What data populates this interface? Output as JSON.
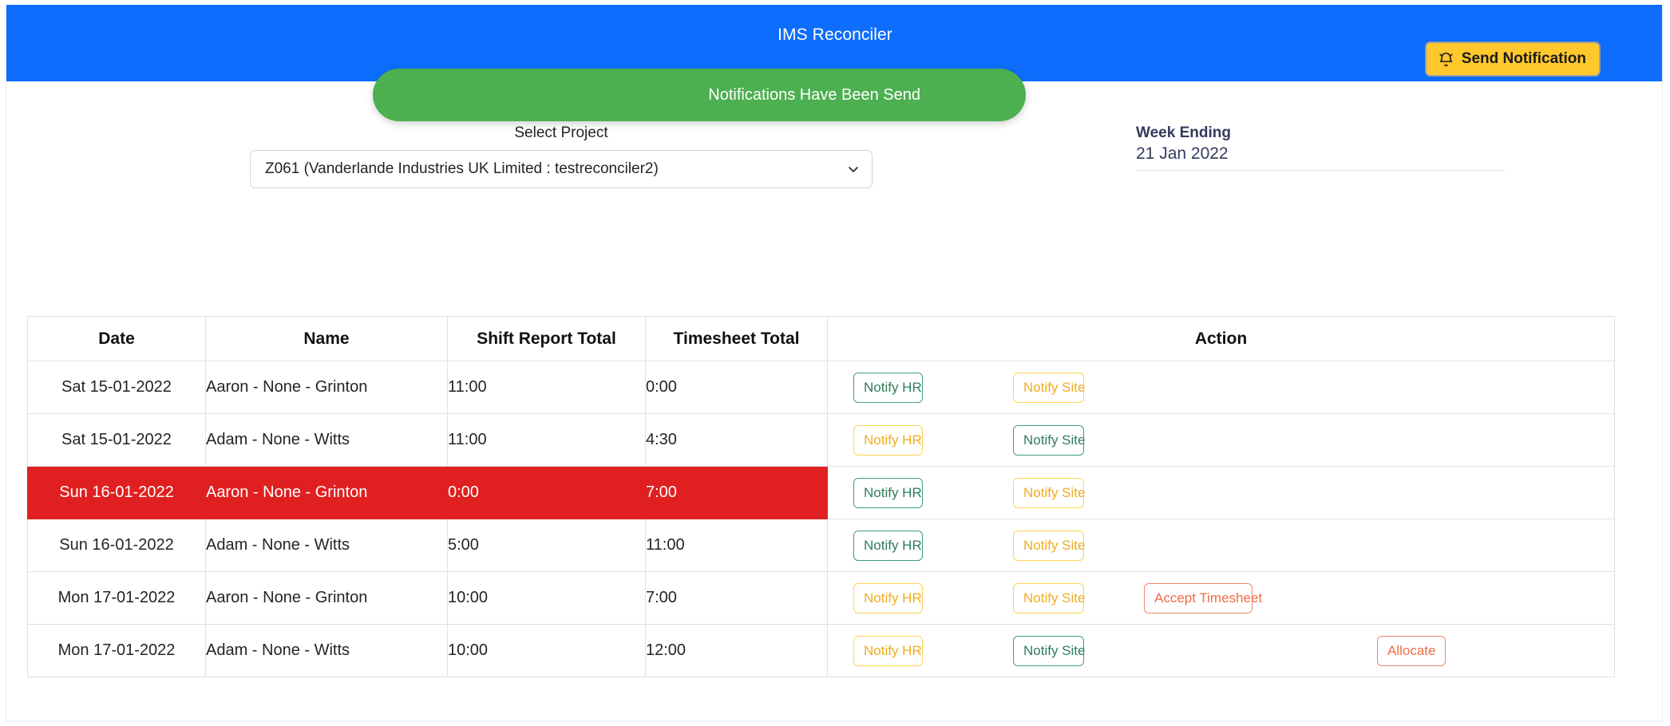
{
  "app": {
    "title": "IMS Reconciler",
    "brand_color": "#0d6efd"
  },
  "header": {
    "send_notification_label": "Send Notification",
    "send_notification_icon": "bell-icon",
    "send_notification_bg": "#ffc82c"
  },
  "toast": {
    "message": "Notifications Have Been Send",
    "bg_color": "#4caf50"
  },
  "filters": {
    "project_label": "Select Project",
    "project_selected": "Z061 (Vanderlande Industries UK Limited : testreconciler2)",
    "project_options": [
      "Z061 (Vanderlande Industries UK Limited : testreconciler2)"
    ],
    "caret_icon": "chevron-down-icon",
    "week_ending_label": "Week Ending",
    "week_ending_value": "21 Jan 2022"
  },
  "table": {
    "columns": [
      "Date",
      "Name",
      "Shift Report Total",
      "Timesheet Total",
      "Action"
    ],
    "alert_row_color": "#e02020",
    "rows": [
      {
        "date": "Sat 15-01-2022",
        "name": "Aaron - None - Grinton",
        "shift_total": "11:00",
        "timesheet_total": "0:00",
        "alert": false,
        "notify_hr": {
          "label": "Notify HR",
          "style": "green"
        },
        "notify_site": {
          "label": "Notify Site",
          "style": "yellow"
        },
        "accept_timesheet": null,
        "allocate": null
      },
      {
        "date": "Sat 15-01-2022",
        "name": "Adam - None - Witts",
        "shift_total": "11:00",
        "timesheet_total": "4:30",
        "alert": false,
        "notify_hr": {
          "label": "Notify HR",
          "style": "yellow"
        },
        "notify_site": {
          "label": "Notify Site",
          "style": "green"
        },
        "accept_timesheet": null,
        "allocate": null
      },
      {
        "date": "Sun 16-01-2022",
        "name": "Aaron - None - Grinton",
        "shift_total": "0:00",
        "timesheet_total": "7:00",
        "alert": true,
        "notify_hr": {
          "label": "Notify HR",
          "style": "green"
        },
        "notify_site": {
          "label": "Notify Site",
          "style": "yellow"
        },
        "accept_timesheet": null,
        "allocate": null
      },
      {
        "date": "Sun 16-01-2022",
        "name": "Adam - None - Witts",
        "shift_total": "5:00",
        "timesheet_total": "11:00",
        "alert": false,
        "notify_hr": {
          "label": "Notify HR",
          "style": "green"
        },
        "notify_site": {
          "label": "Notify Site",
          "style": "yellow"
        },
        "accept_timesheet": null,
        "allocate": null
      },
      {
        "date": "Mon 17-01-2022",
        "name": "Aaron - None - Grinton",
        "shift_total": "10:00",
        "timesheet_total": "7:00",
        "alert": false,
        "notify_hr": {
          "label": "Notify HR",
          "style": "yellow"
        },
        "notify_site": {
          "label": "Notify Site",
          "style": "yellow"
        },
        "accept_timesheet": {
          "label": "Accept Timesheet",
          "style": "salmon"
        },
        "allocate": null
      },
      {
        "date": "Mon 17-01-2022",
        "name": "Adam - None - Witts",
        "shift_total": "10:00",
        "timesheet_total": "12:00",
        "alert": false,
        "notify_hr": {
          "label": "Notify HR",
          "style": "yellow"
        },
        "notify_site": {
          "label": "Notify Site",
          "style": "green"
        },
        "accept_timesheet": null,
        "allocate": {
          "label": "Allocate",
          "style": "salmon"
        }
      }
    ]
  }
}
